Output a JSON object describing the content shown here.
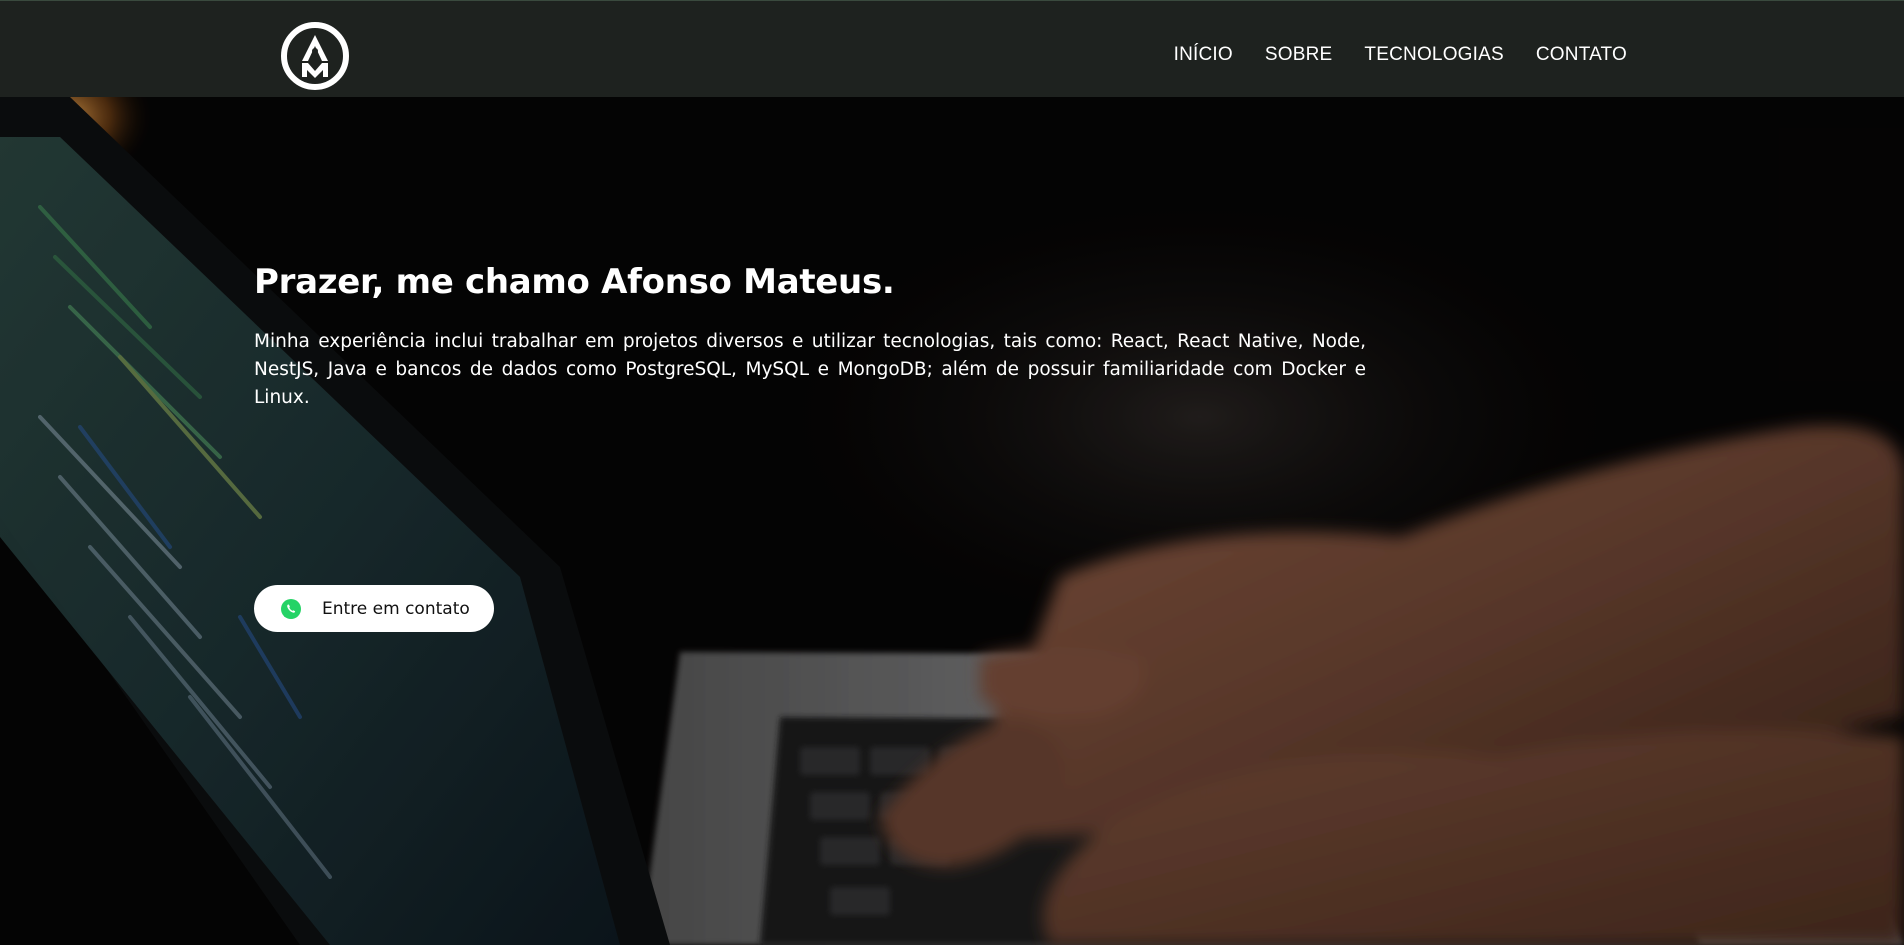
{
  "header": {
    "logo_icon": "am-monogram-logo",
    "nav": [
      {
        "label": "INÍCIO"
      },
      {
        "label": "SOBRE"
      },
      {
        "label": "TECNOLOGIAS"
      },
      {
        "label": "CONTATO"
      }
    ]
  },
  "hero": {
    "title": "Prazer, me chamo Afonso Mateus.",
    "description": "Minha experiência inclui trabalhar em projetos diversos e utilizar tecnologias, tais como: React, React Native, Node, NestJS, Java e bancos de dados como PostgreSQL, MySQL e MongoDB; além de possuir familiaridade com Docker e Linux.",
    "cta": {
      "label": "Entre em contato",
      "icon": "whatsapp-icon"
    },
    "background_image": "laptop-typing-hands-photo"
  },
  "colors": {
    "navbar_bg": "#1e221f",
    "button_bg": "#ffffff",
    "whatsapp_green": "#25d366"
  }
}
